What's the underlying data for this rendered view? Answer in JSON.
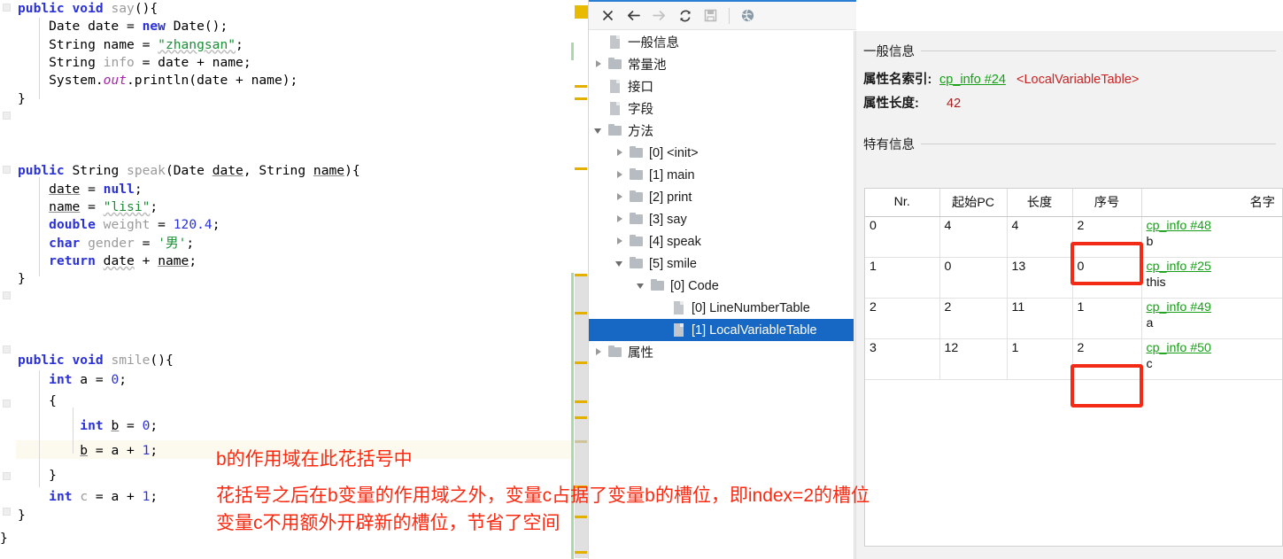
{
  "editor": {
    "lines": [
      "public void say(){",
      "    Date date = new Date();",
      "    String name = \"zhangsan\";",
      "    String info = date + name;",
      "    System.out.println(date + name);",
      "}",
      "",
      "public String speak(Date date, String name){",
      "    date = null;",
      "    name = \"lisi\";",
      "    double weight = 120.4;",
      "    char gender = '男';",
      "    return date + name;",
      "}",
      "",
      "public void smile(){",
      "    int a = 0;",
      "    {",
      "        int b = 0;",
      "        b = a + 1;",
      "    }",
      "    int c = a + 1;",
      "}",
      "}"
    ]
  },
  "annotations": [
    {
      "text": "b的作用域在此花括号中"
    },
    {
      "text": "花括号之后在b变量的作用域之外，变量c占据了变量b的槽位，即index=2的槽位"
    },
    {
      "text": "变量c不用额外开辟新的槽位，节省了空间"
    }
  ],
  "toolbar": {
    "buttons": [
      {
        "name": "close-icon",
        "glyph": "✕",
        "enabled": true
      },
      {
        "name": "back-arrow-icon",
        "glyph": "←",
        "enabled": true
      },
      {
        "name": "forward-arrow-icon",
        "glyph": "→",
        "enabled": false
      },
      {
        "name": "refresh-icon",
        "glyph": "↻",
        "enabled": true
      },
      {
        "name": "save-icon",
        "glyph": "🖫",
        "enabled": false
      },
      {
        "name": "browser-globe-icon",
        "glyph": "🌐",
        "enabled": true
      }
    ]
  },
  "tree": {
    "items": [
      {
        "label": "一般信息",
        "depth": 1,
        "icon": "file",
        "twist": "none",
        "selected": false
      },
      {
        "label": "常量池",
        "depth": 1,
        "icon": "folder",
        "twist": "closed",
        "selected": false
      },
      {
        "label": "接口",
        "depth": 1,
        "icon": "file",
        "twist": "none",
        "selected": false
      },
      {
        "label": "字段",
        "depth": 1,
        "icon": "file",
        "twist": "none",
        "selected": false
      },
      {
        "label": "方法",
        "depth": 1,
        "icon": "folder",
        "twist": "open",
        "selected": false
      },
      {
        "label": "[0] <init>",
        "depth": 2,
        "icon": "folder",
        "twist": "closed",
        "selected": false
      },
      {
        "label": "[1] main",
        "depth": 2,
        "icon": "folder",
        "twist": "closed",
        "selected": false
      },
      {
        "label": "[2] print",
        "depth": 2,
        "icon": "folder",
        "twist": "closed",
        "selected": false
      },
      {
        "label": "[3] say",
        "depth": 2,
        "icon": "folder",
        "twist": "closed",
        "selected": false
      },
      {
        "label": "[4] speak",
        "depth": 2,
        "icon": "folder",
        "twist": "closed",
        "selected": false
      },
      {
        "label": "[5] smile",
        "depth": 2,
        "icon": "folder",
        "twist": "open",
        "selected": false
      },
      {
        "label": "[0] Code",
        "depth": 3,
        "icon": "folder",
        "twist": "open",
        "selected": false
      },
      {
        "label": "[0] LineNumberTable",
        "depth": 4,
        "icon": "file",
        "twist": "none",
        "selected": false
      },
      {
        "label": "[1] LocalVariableTable",
        "depth": 4,
        "icon": "file",
        "twist": "none",
        "selected": true
      },
      {
        "label": "属性",
        "depth": 1,
        "icon": "folder",
        "twist": "closed",
        "selected": false
      }
    ]
  },
  "detail": {
    "general_section_title": "一般信息",
    "attr_name_index_label": "属性名索引:",
    "attr_name_index_link": "cp_info #24",
    "attr_name_index_desc": "<LocalVariableTable>",
    "attr_length_label": "属性长度:",
    "attr_length_value": "42",
    "specific_section_title": "特有信息",
    "table": {
      "columns": [
        "Nr.",
        "起始PC",
        "长度",
        "序号",
        "名字"
      ],
      "rows": [
        {
          "nr": "0",
          "start_pc": "4",
          "length": "4",
          "index": "2",
          "cp_link": "cp_info #48",
          "name": "b",
          "index_highlighted": true
        },
        {
          "nr": "1",
          "start_pc": "0",
          "length": "13",
          "index": "0",
          "cp_link": "cp_info #25",
          "name": "this",
          "index_highlighted": false
        },
        {
          "nr": "2",
          "start_pc": "2",
          "length": "11",
          "index": "1",
          "cp_link": "cp_info #49",
          "name": "a",
          "index_highlighted": false
        },
        {
          "nr": "3",
          "start_pc": "12",
          "length": "1",
          "index": "2",
          "cp_link": "cp_info #50",
          "name": "c",
          "index_highlighted": true
        }
      ]
    }
  },
  "colors": {
    "accent_blue": "#1668c4",
    "annotation_red": "#fa2a12",
    "link_green": "#18a018",
    "warn_yellow": "#e2b100",
    "vcs_green": "#a8dba8"
  }
}
